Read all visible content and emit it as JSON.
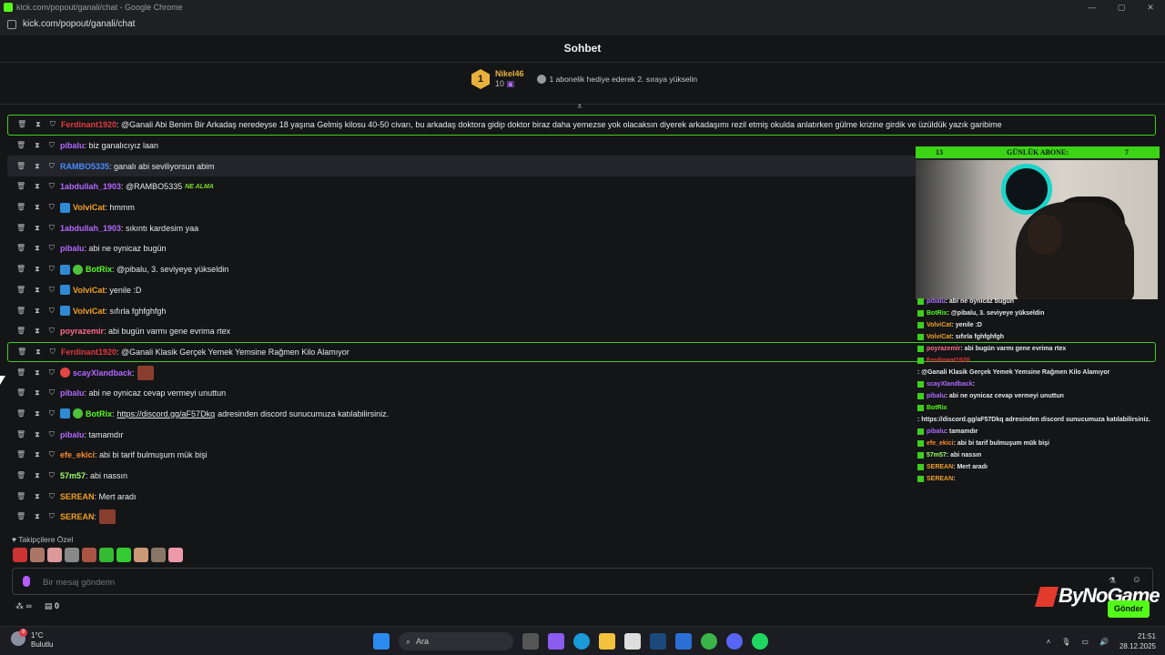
{
  "browser": {
    "title": "kick.com/popout/ganali/chat - Google Chrome",
    "url": "kick.com/popout/ganali/chat",
    "controls": [
      "—",
      "▢",
      "✕"
    ]
  },
  "chat_header": {
    "title": "Sohbet"
  },
  "top_gifter": {
    "rank": "1",
    "name": "Nikel46",
    "count": "10",
    "message": "1 abonelik hediye ederek 2. sıraya yükselin"
  },
  "messages": [
    {
      "user": "Ferdinant1920",
      "color": "#e0393e",
      "text": ": @Ganali Abi Benim Bir Arkadaş neredeyse 18 yaşına Gelmiş kilosu 40-50 civarı, bu arkadaş doktora gidip doktor biraz daha yemezse yok olacaksın diyerek arkadaşımı rezil etmiş okulda anlatırken gülme krizine girdik ve üzüldük yazık garibime",
      "highlight": true
    },
    {
      "user": "pibalu",
      "color": "#b169ff",
      "text": ": biz ganalıcıyız laan"
    },
    {
      "user": "RAMBO5335",
      "color": "#4a8cff",
      "text": ": ganalı abi seviliyorsun abim",
      "hover": true
    },
    {
      "user": "1abdullah_1903",
      "color": "#b169ff",
      "text": ": @RAMBO5335",
      "emote_text": "NE ALMA"
    },
    {
      "user": "VolviCat",
      "color": "#f0a020",
      "text": ": hmmm",
      "badge": "blue"
    },
    {
      "user": "1abdullah_1903",
      "color": "#b169ff",
      "text": ": sıkıntı kardesim yaa"
    },
    {
      "user": "pibalu",
      "color": "#b169ff",
      "text": ": abi ne oynicaz bugün"
    },
    {
      "user": "BotRix",
      "color": "#53fc18",
      "text": ": @pibalu, 3. seviyeye yükseldin",
      "badge": "bot"
    },
    {
      "user": "VolviCat",
      "color": "#f0a020",
      "text": ": yenile :D",
      "badge": "blue"
    },
    {
      "user": "VolviCat",
      "color": "#f0a020",
      "text": ": sıfırla fghfghfgh",
      "badge": "blue"
    },
    {
      "user": "poyrazemir",
      "color": "#ff6b8a",
      "text": ": abi bugün varmı gene evrima rtex"
    },
    {
      "user": "Ferdinant1920",
      "color": "#e0393e",
      "text": ": @Ganali Klasik Gerçek Yemek Yemsine Rağmen Kilo Alamıyor",
      "highlight": true
    },
    {
      "user": "scayXlandback",
      "color": "#b169ff",
      "text": ":",
      "badge": "red",
      "emote": true
    },
    {
      "user": "pibalu",
      "color": "#b169ff",
      "text": ": abi ne oynicaz cevap vermeyi unuttun"
    },
    {
      "user": "BotRix",
      "color": "#53fc18",
      "text": ":",
      "badge": "bot",
      "link": "https://discord.gg/aF57Dkq",
      "after": "adresinden discord sunucumuza katılabilirsiniz."
    },
    {
      "user": "pibalu",
      "color": "#b169ff",
      "text": ": tamamdır"
    },
    {
      "user": "efe_ekici",
      "color": "#ff8a2a",
      "text": ": abi bi tarif bulmuşum mük bişi"
    },
    {
      "user": "57m57",
      "color": "#9cff6a",
      "text": ": abi nassın"
    },
    {
      "user": "SEREAN",
      "color": "#f0a020",
      "text": ": Mert aradı"
    },
    {
      "user": "SEREAN",
      "color": "#f0a020",
      "text": ":",
      "emote": true
    }
  ],
  "followers_label": "Takipçilere Özel",
  "emote_colors": [
    "#c33",
    "#a76",
    "#d99",
    "#888",
    "#a54",
    "#3b3",
    "#3c3",
    "#c97",
    "#876",
    "#e9a"
  ],
  "input": {
    "placeholder": "Bir mesaj gönderin"
  },
  "bottom": {
    "count": "0",
    "send": "Gönder"
  },
  "overlay": {
    "bar_left": "13",
    "bar_center": "GÜNLÜK ABONE:",
    "bar_right": "7",
    "brand": "ByNoGame",
    "chat": [
      {
        "user": "pibalu",
        "color": "#b169ff",
        "text": ": abi ne oynicaz bugün"
      },
      {
        "user": "BotRix",
        "color": "#53fc18",
        "text": ": @pibalu, 3. seviyeye yükseldin"
      },
      {
        "user": "VolviCat",
        "color": "#f0a020",
        "text": ": yenile :D"
      },
      {
        "user": "VolviCat",
        "color": "#f0a020",
        "text": ": sıfırla fghfghfgh"
      },
      {
        "user": "poyrazemir",
        "color": "#ff6b8a",
        "text": ": abi bugün varmı gene evrima rtex"
      },
      {
        "user": "Ferdinant1920",
        "color": "#e0393e",
        "text": ": @Ganali Klasik Gerçek Yemek Yemsine Rağmen Kilo Alamıyor"
      },
      {
        "user": "scayXlandback",
        "color": "#b169ff",
        "text": " :"
      },
      {
        "user": "pibalu",
        "color": "#b169ff",
        "text": ": abi ne oynicaz cevap vermeyi unuttun"
      },
      {
        "user": "BotRix",
        "color": "#53fc18",
        "text": ": https://discord.gg/aF57Dkq adresinden discord sunucumuza katılabilirsiniz."
      },
      {
        "user": "pibalu",
        "color": "#b169ff",
        "text": ": tamamdır"
      },
      {
        "user": "efe_ekici",
        "color": "#ff8a2a",
        "text": ": abi bi tarif bulmuşum mük bişi"
      },
      {
        "user": "57m57",
        "color": "#9cff6a",
        "text": ": abi nassın"
      },
      {
        "user": "SEREAN",
        "color": "#f0a020",
        "text": ": Mert aradı"
      },
      {
        "user": "SEREAN",
        "color": "#f0a020",
        "text": " :"
      }
    ]
  },
  "taskbar": {
    "temp": "1°C",
    "weather": "Bulutlu",
    "notif": "9",
    "search": "Ara",
    "time": "21:51",
    "date": "28.12.2025"
  }
}
